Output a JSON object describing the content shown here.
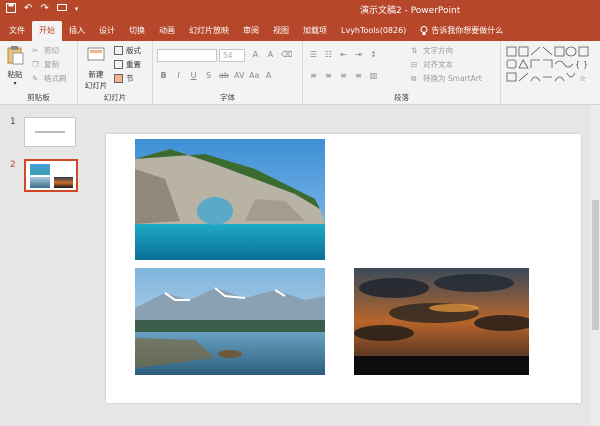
{
  "window": {
    "title": "演示文稿2 - PowerPoint"
  },
  "qat": {
    "save_icon": "save-icon",
    "undo": "↶",
    "redo": "↷"
  },
  "tabs": [
    {
      "label": "文件"
    },
    {
      "label": "开始"
    },
    {
      "label": "插入"
    },
    {
      "label": "设计"
    },
    {
      "label": "切换"
    },
    {
      "label": "动画"
    },
    {
      "label": "幻灯片放映"
    },
    {
      "label": "审阅"
    },
    {
      "label": "视图"
    },
    {
      "label": "加载项"
    },
    {
      "label": "LvyhTools(0826)"
    }
  ],
  "tell_me": "告诉我你想要做什么",
  "ribbon": {
    "clipboard": {
      "label": "剪贴板",
      "paste": "粘贴",
      "cut": "剪切",
      "copy": "复制",
      "format_painter": "格式刷"
    },
    "slides": {
      "label": "幻灯片",
      "new_slide": "新建",
      "new_slide_2": "幻灯片",
      "layout": "版式",
      "reset": "重置",
      "section": "节"
    },
    "font": {
      "label": "字体",
      "font_name": "",
      "font_size": "54"
    },
    "paragraph": {
      "label": "段落",
      "text_direction": "文字方向",
      "align_text": "对齐文本",
      "smartart": "转换为 SmartArt"
    }
  },
  "thumbnails": [
    {
      "number": "1"
    },
    {
      "number": "2"
    }
  ],
  "accent": "#b7472a"
}
